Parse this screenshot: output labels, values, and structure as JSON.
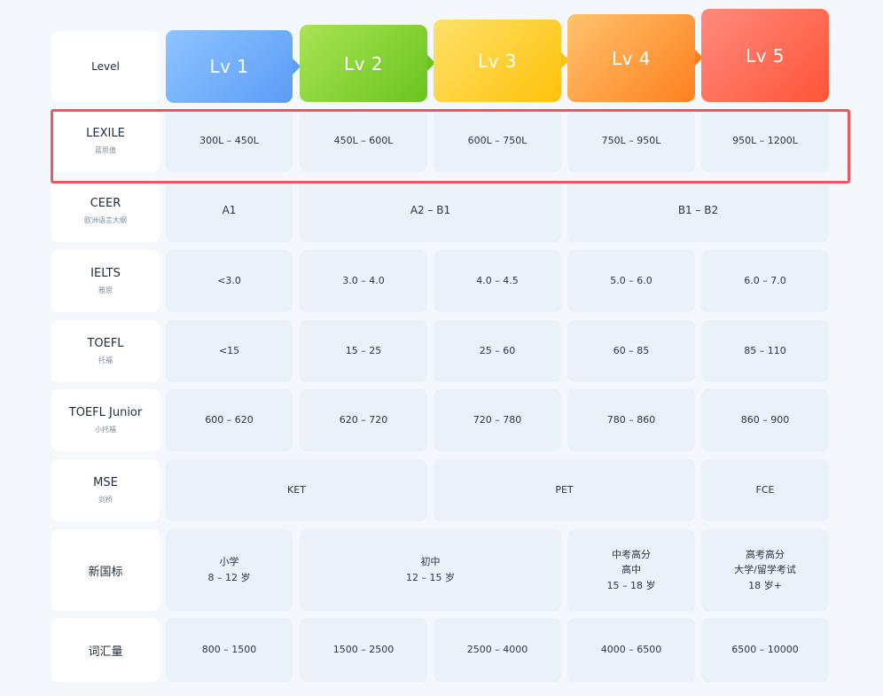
{
  "header": {
    "level_label": "Level",
    "levels": [
      {
        "label": "Lv 1",
        "color_from": "#8ec4ff",
        "color_to": "#5b9cf7"
      },
      {
        "label": "Lv 2",
        "color_from": "#a9e355",
        "color_to": "#6bc41e"
      },
      {
        "label": "Lv 3",
        "color_from": "#fde16a",
        "color_to": "#ffc20a"
      },
      {
        "label": "Lv 4",
        "color_from": "#ffc36c",
        "color_to": "#ff7f1e"
      },
      {
        "label": "Lv 5",
        "color_from": "#ff8a7e",
        "color_to": "#ff5436"
      }
    ]
  },
  "rows": {
    "lexile": {
      "title": "LEXILE",
      "subtitle": "蓝思值",
      "cells": [
        "300L – 450L",
        "450L – 600L",
        "600L – 750L",
        "750L – 950L",
        "950L – 1200L"
      ]
    },
    "ceer": {
      "title": "CEER",
      "subtitle": "欧洲语言大纲",
      "cells": [
        "A1",
        "A2 – B1",
        "B1 – B2"
      ]
    },
    "ielts": {
      "title": "IELTS",
      "subtitle": "雅思",
      "cells": [
        "<3.0",
        "3.0 – 4.0",
        "4.0 – 4.5",
        "5.0 – 6.0",
        "6.0 – 7.0"
      ]
    },
    "toefl": {
      "title": "TOEFL",
      "subtitle": "托福",
      "cells": [
        "<15",
        "15 – 25",
        "25 – 60",
        "60 – 85",
        "85 – 110"
      ]
    },
    "toefl_junior": {
      "title": "TOEFL Junior",
      "subtitle": "小托福",
      "cells": [
        "600 – 620",
        "620 – 720",
        "720 – 780",
        "780 – 860",
        "860 – 900"
      ]
    },
    "mse": {
      "title": "MSE",
      "subtitle": "剑桥",
      "cells": [
        "KET",
        "PET",
        "FCE"
      ]
    },
    "xinguobiao": {
      "title": "新国标",
      "cells": [
        {
          "line1": "小学",
          "line2": "8 – 12 岁"
        },
        {
          "line1": "初中",
          "line2": "12 – 15 岁"
        },
        {
          "line1": "中考高分",
          "line2": "高中",
          "line3": "15 – 18 岁"
        },
        {
          "line1": "高考高分",
          "line2": "大学/留学考试",
          "line3": "18 岁+"
        }
      ]
    },
    "vocab": {
      "title": "词汇量",
      "cells": [
        "800 – 1500",
        "1500 – 2500",
        "2500 – 4000",
        "4000 – 6500",
        "6500 – 10000"
      ]
    }
  },
  "highlight_color": "#ec5861"
}
